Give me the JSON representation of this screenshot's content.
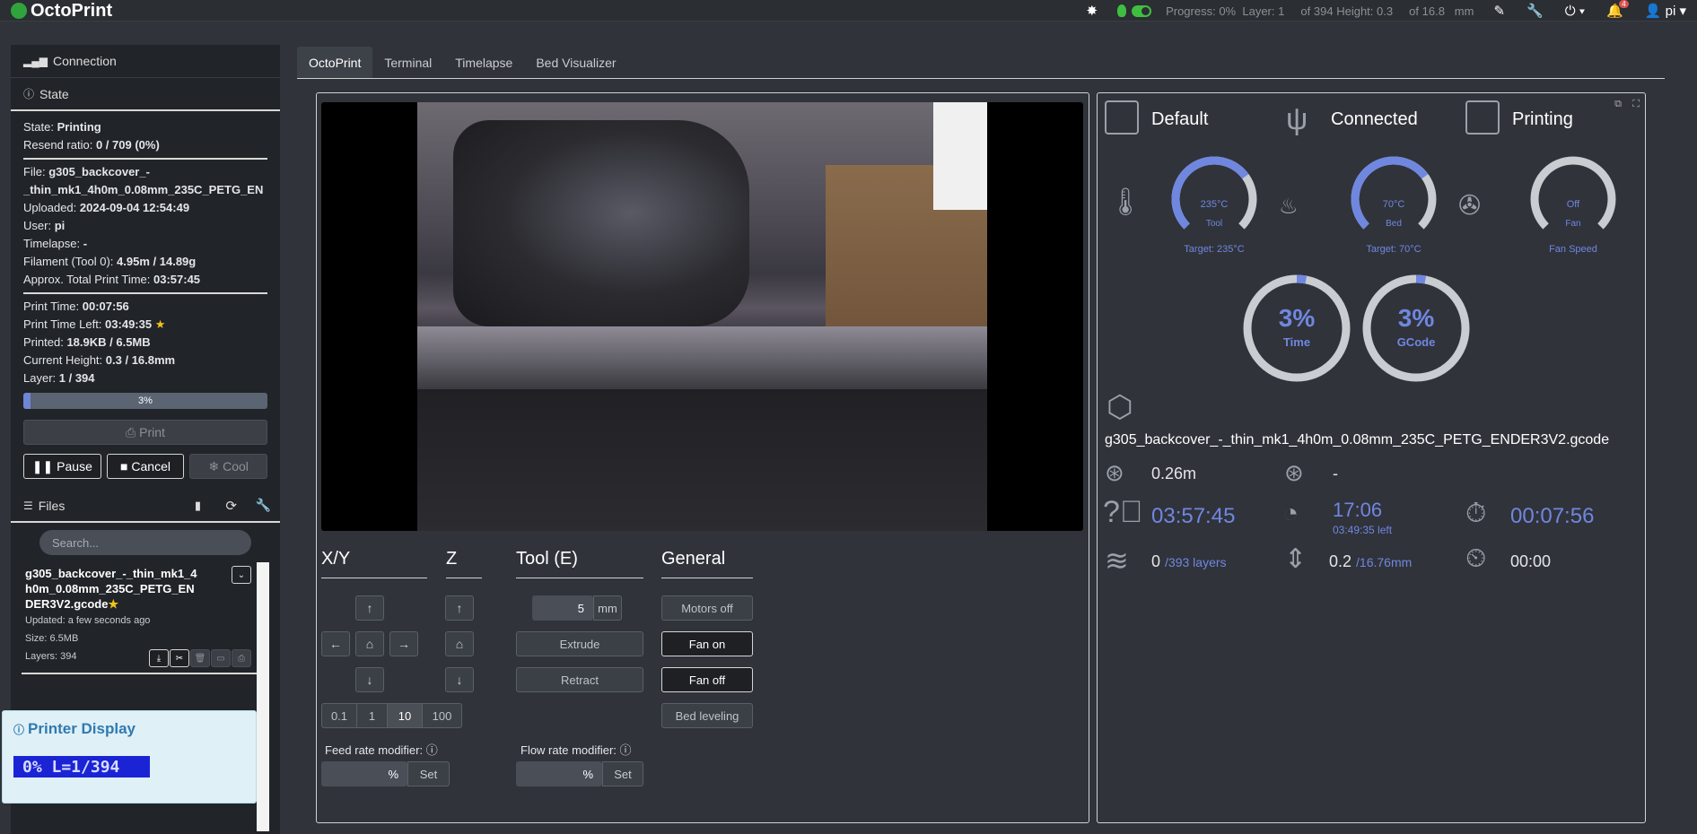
{
  "navbar": {
    "brand": "OctoPrint",
    "status": {
      "progress_label": "Progress:",
      "progress_value": "0%",
      "layer_label": "Layer:",
      "layer_value": "1",
      "layer_total": "of 394",
      "height_label": "Height:",
      "height_value": "0.3",
      "height_total": "of 16.8",
      "height_unit": "mm"
    },
    "notifications_count": "4",
    "user": "pi"
  },
  "sidebar": {
    "connection_title": "Connection",
    "state_title": "State",
    "state": [
      {
        "label": "State:",
        "value": "Printing"
      },
      {
        "label": "Resend ratio:",
        "value": "0 / 709 (0%)"
      }
    ],
    "file_label": "File:",
    "file_value_line1": "g305_backcover_-",
    "file_value_line2": "_thin_mk1_4h0m_0.08mm_235C_PETG_EN",
    "file_info": [
      {
        "label": "Uploaded:",
        "value": "2024-09-04 12:54:49"
      },
      {
        "label": "User:",
        "value": "pi"
      },
      {
        "label": "Timelapse:",
        "value": "-"
      },
      {
        "label": "Filament (Tool 0):",
        "value": "4.95m / 14.89g"
      },
      {
        "label": "Approx. Total Print Time:",
        "value": "03:57:45"
      }
    ],
    "print_info": [
      {
        "label": "Print Time:",
        "value": "00:07:56"
      },
      {
        "label": "Print Time Left:",
        "value": "03:49:35"
      },
      {
        "label": "Printed:",
        "value": "18.9KB / 6.5MB"
      },
      {
        "label": "Current Height:",
        "value": "0.3 / 16.8mm"
      },
      {
        "label": "Layer:",
        "value": "1 / 394"
      }
    ],
    "progress_percent": 3,
    "progress_text": "3%",
    "buttons": {
      "print": "Print",
      "pause": "Pause",
      "cancel": "Cancel",
      "cool": "Cool"
    },
    "files_title": "Files",
    "search_placeholder": "Search...",
    "file_entry": {
      "name_line1": "g305_backcover_-_thin_mk1_4",
      "name_line2": "h0m_0.08mm_235C_PETG_EN",
      "name_line3": "DER3V2.gcode",
      "updated": "Updated: a few seconds ago",
      "size": "Size: 6.5MB",
      "layers": "Layers: 394"
    }
  },
  "printer_display": {
    "title": "Printer Display",
    "lcd_text": "0% L=1/394"
  },
  "tabs": [
    "OctoPrint",
    "Terminal",
    "Timelapse",
    "Bed Visualizer"
  ],
  "control": {
    "xy_label": "X/Y",
    "z_label": "Z",
    "tool_label": "Tool (E)",
    "general_label": "General",
    "step_sizes": [
      "0.1",
      "1",
      "10",
      "100"
    ],
    "extrude_amount": "5",
    "extrude_unit": "mm",
    "extrude_btn": "Extrude",
    "retract_btn": "Retract",
    "motors_off": "Motors off",
    "fan_on": "Fan on",
    "fan_off": "Fan off",
    "bed_leveling": "Bed leveling",
    "feed_rate_label": "Feed rate modifier:",
    "flow_rate_label": "Flow rate modifier:",
    "percent": "%",
    "set": "Set"
  },
  "dashboard": {
    "profile": "Default",
    "connection": "Connected",
    "state": "Printing",
    "gauges": [
      {
        "value": "235°C",
        "name": "Tool",
        "target": "Target: 235°C",
        "level": 0.7
      },
      {
        "value": "70°C",
        "name": "Bed",
        "target": "Target: 70°C",
        "level": 0.7
      },
      {
        "value": "Off",
        "name": "Fan",
        "target": "Fan Speed",
        "level": 0
      }
    ],
    "progress_time": {
      "value": "3%",
      "name": "Time",
      "level": 0.03
    },
    "progress_gcode": {
      "value": "3%",
      "name": "GCode",
      "level": 0.03
    },
    "filename": "g305_backcover_-_thin_mk1_4h0m_0.08mm_235C_PETG_ENDER3V2.gcode",
    "filament": "0.26m",
    "filament_weight": "-",
    "est_total": "03:57:45",
    "eta": "17:06",
    "eta_left": "03:49:35 left",
    "elapsed": "00:07:56",
    "layer": "0",
    "layer_total": "/393 layers",
    "height": "0.2",
    "height_total": "/16.76mm",
    "layer_time": "00:00"
  },
  "colors": {
    "accent": "#7087e0",
    "brand_green": "#2fa43d",
    "lcd_blue": "#1b24d4"
  }
}
